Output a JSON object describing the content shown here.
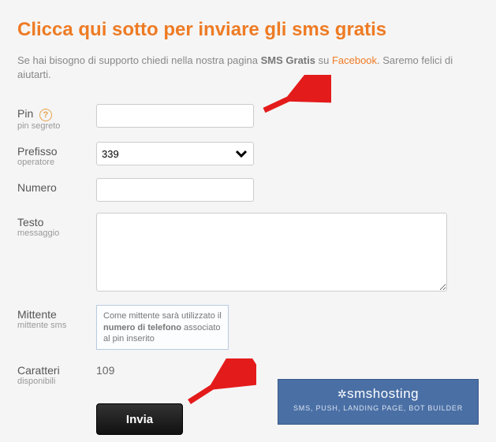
{
  "heading": "Clicca qui sotto per inviare gli sms gratis",
  "intro": {
    "part1": "Se hai bisogno di supporto chiedi nella nostra pagina ",
    "bold": "SMS Gratis",
    "part2": " su ",
    "link": "Facebook",
    "part3": ". Saremo felici di aiutarti."
  },
  "fields": {
    "pin": {
      "label": "Pin",
      "sub": "pin segreto",
      "value": ""
    },
    "prefisso": {
      "label": "Prefisso",
      "sub": "operatore",
      "value": "339"
    },
    "numero": {
      "label": "Numero",
      "value": ""
    },
    "testo": {
      "label": "Testo",
      "sub": "messaggio",
      "value": ""
    },
    "mittente": {
      "label": "Mittente",
      "sub": "mittente sms",
      "info_1": "Come mittente sarà utilizzato il ",
      "info_bold": "numero di telefono",
      "info_2": " associato al pin inserito"
    },
    "caratteri": {
      "label": "Caratteri",
      "sub": "disponibili",
      "value": "109"
    }
  },
  "submit": "Invia",
  "promo": {
    "title": "smshosting",
    "sub": "SMS, PUSH, LANDING PAGE, BOT BUILDER"
  },
  "help_icon_glyph": "?"
}
